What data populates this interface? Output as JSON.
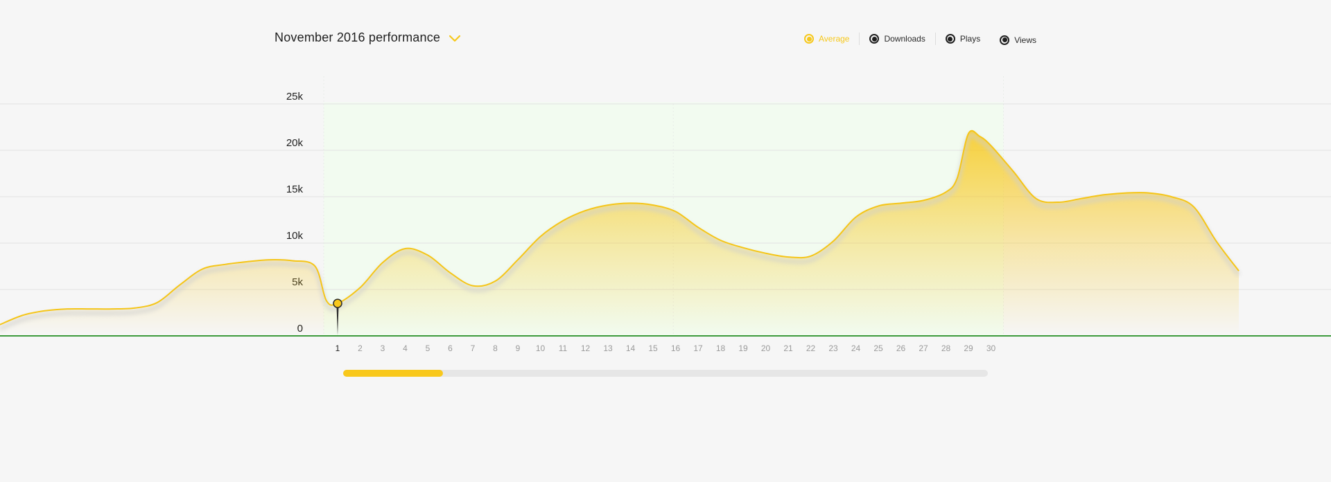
{
  "header": {
    "title": "November 2016 performance",
    "dropdown_icon": "chevron-down-icon"
  },
  "legend": {
    "items": [
      {
        "label": "Average",
        "active": true
      },
      {
        "label": "Downloads",
        "active": false
      },
      {
        "label": "Plays",
        "active": false
      },
      {
        "label": "Views",
        "active": false
      }
    ]
  },
  "colors": {
    "accent": "#f8c81c",
    "line": "#f5c518",
    "baseline": "#3c9a3c",
    "grid": "#e2e2e2",
    "highlight_band": "#f2fbf0",
    "text": "#1e1e1e",
    "tick_text": "#9a9a9a"
  },
  "scrollbar": {
    "position": 0.0,
    "visible_fraction": 0.155
  },
  "chart_data": {
    "type": "area",
    "title": "November 2016 performance",
    "xlabel": "",
    "ylabel": "",
    "y_ticks": [
      "0",
      "5k",
      "10k",
      "15k",
      "20k",
      "25k"
    ],
    "ylim": [
      0,
      25000
    ],
    "grid": true,
    "highlighted_x_range": [
      1,
      30
    ],
    "selected_point": {
      "x": 1,
      "value": 3500
    },
    "x_tick_labels": [
      "1",
      "2",
      "3",
      "4",
      "5",
      "6",
      "7",
      "8",
      "9",
      "10",
      "11",
      "12",
      "13",
      "14",
      "15",
      "16",
      "17",
      "18",
      "19",
      "20",
      "21",
      "22",
      "23",
      "24",
      "25",
      "26",
      "27",
      "28",
      "29",
      "30"
    ],
    "series": [
      {
        "name": "Average",
        "x": [
          -14,
          -13,
          -12,
          -11,
          -10,
          -9,
          -8,
          -7,
          -6,
          -5,
          -4,
          -3,
          -2,
          -1,
          0,
          0.5,
          1,
          2,
          3,
          4,
          5,
          6,
          7,
          8,
          9,
          10,
          11,
          12,
          13,
          14,
          15,
          16,
          17,
          18,
          19,
          20,
          21,
          22,
          23,
          24,
          25,
          26,
          27,
          28,
          28.5,
          29,
          29.5,
          30,
          31,
          32,
          33,
          34,
          35,
          36,
          37,
          38,
          39,
          40,
          41
        ],
        "values": [
          1200,
          2200,
          2700,
          2900,
          2900,
          2900,
          3000,
          3600,
          5500,
          7200,
          7700,
          8000,
          8200,
          8100,
          7500,
          3800,
          3500,
          5200,
          7900,
          9400,
          8700,
          6800,
          5400,
          5900,
          8200,
          10700,
          12400,
          13500,
          14100,
          14300,
          14100,
          13400,
          11700,
          10300,
          9500,
          8900,
          8500,
          8600,
          10200,
          12800,
          14000,
          14300,
          14600,
          15500,
          17000,
          21800,
          21500,
          20500,
          17700,
          14800,
          14400,
          14800,
          15200,
          15400,
          15400,
          15000,
          13900,
          10200,
          7000
        ]
      }
    ]
  }
}
